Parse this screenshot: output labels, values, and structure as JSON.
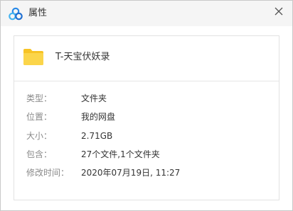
{
  "window": {
    "title": "属性",
    "icons": {
      "app": "baidu-netdisk-logo-icon",
      "close": "close-icon",
      "folder": "folder-icon"
    }
  },
  "file": {
    "name": "T-天宝伏妖录"
  },
  "properties": [
    {
      "label": "类型：",
      "value": "文件夹"
    },
    {
      "label": "位置：",
      "value": "我的网盘"
    },
    {
      "label": "大小：",
      "value": "2.71GB"
    },
    {
      "label": "包含：",
      "value": "27个文件,1个文件夹"
    },
    {
      "label": "修改时间：",
      "value": "2020年07月19日, 11:27"
    }
  ],
  "colors": {
    "folder": "#f7c325",
    "accent": "#2a8ae8"
  }
}
